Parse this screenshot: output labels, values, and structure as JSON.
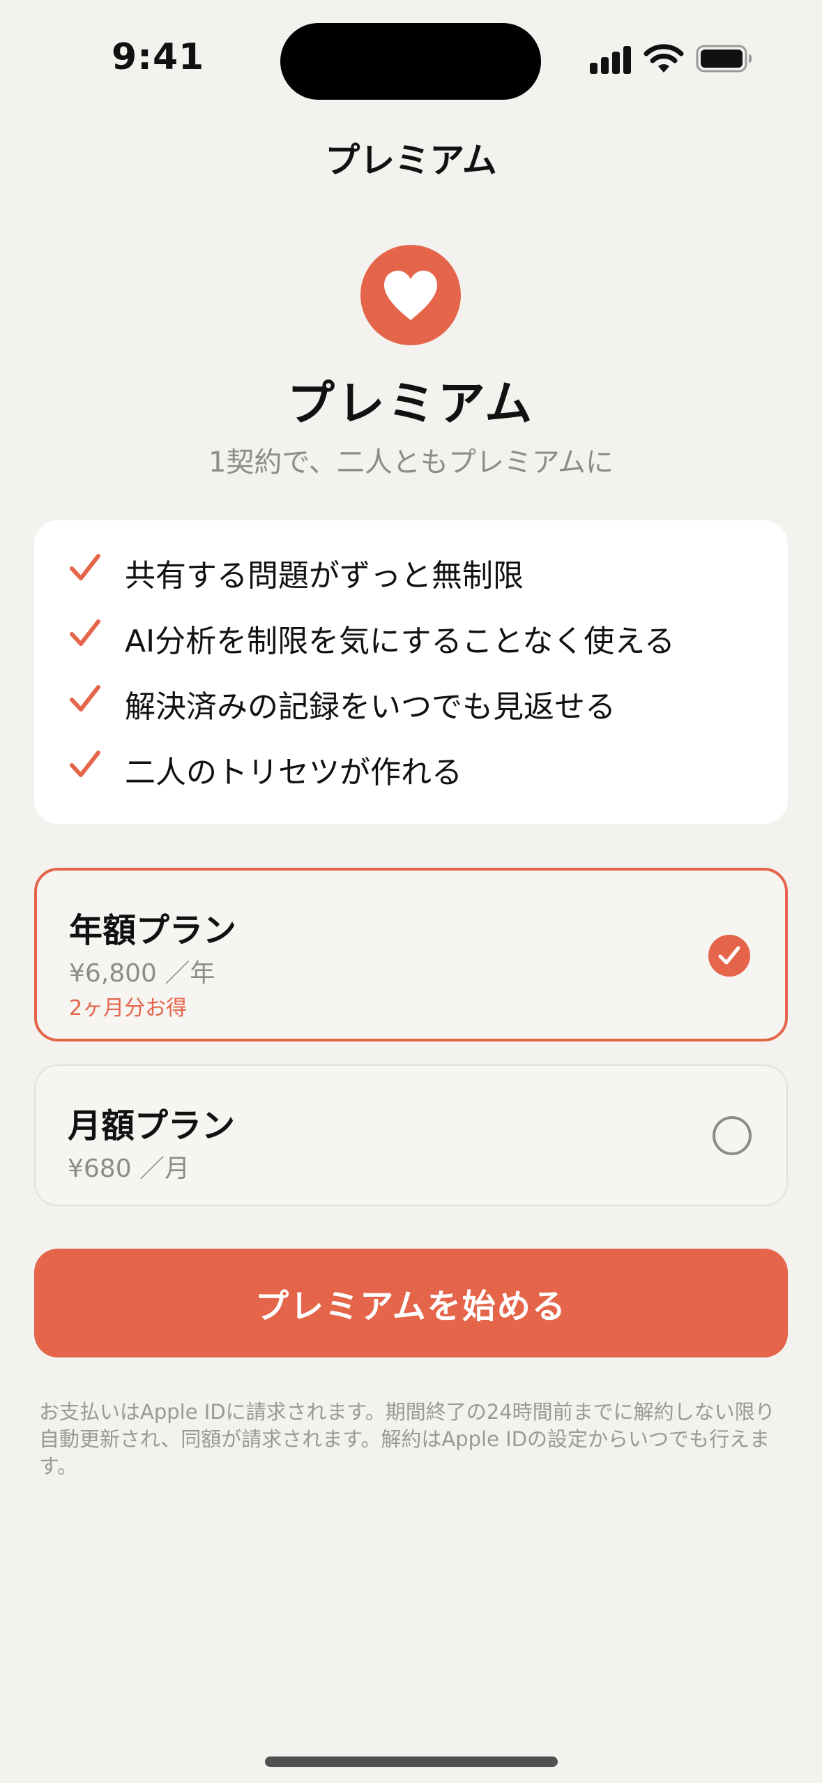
{
  "status_bar": {
    "time": "9:41"
  },
  "nav": {
    "title": "プレミアム"
  },
  "hero": {
    "icon": "heart-icon",
    "title": "プレミアム",
    "subtitle": "1契約で、二人ともプレミアムに"
  },
  "features": [
    {
      "icon": "checkmark-icon",
      "label": "共有する問題がずっと無制限"
    },
    {
      "icon": "checkmark-icon",
      "label": "AI分析を制限を気にすることなく使える"
    },
    {
      "icon": "checkmark-icon",
      "label": "解決済みの記録をいつでも見返せる"
    },
    {
      "icon": "checkmark-icon",
      "label": "二人のトリセツが作れる"
    }
  ],
  "plans": {
    "yearly": {
      "name": "年額プラン",
      "price": "¥6,800 ／年",
      "note": "2ヶ月分お得",
      "selected": true
    },
    "monthly": {
      "name": "月額プラン",
      "price": "¥680 ／月",
      "selected": false
    }
  },
  "cta": {
    "label": "プレミアムを始める"
  },
  "legal": {
    "text": "お支払いはApple IDに請求されます。期間終了の24時間前までに解約しない限り自動更新され、同額が請求されます。解約はApple IDの設定からいつでも行えます。"
  },
  "colors": {
    "accent": "#e4654a",
    "background": "#f3f2ef",
    "card": "#ffffff",
    "muted_text": "#8e8c88"
  }
}
